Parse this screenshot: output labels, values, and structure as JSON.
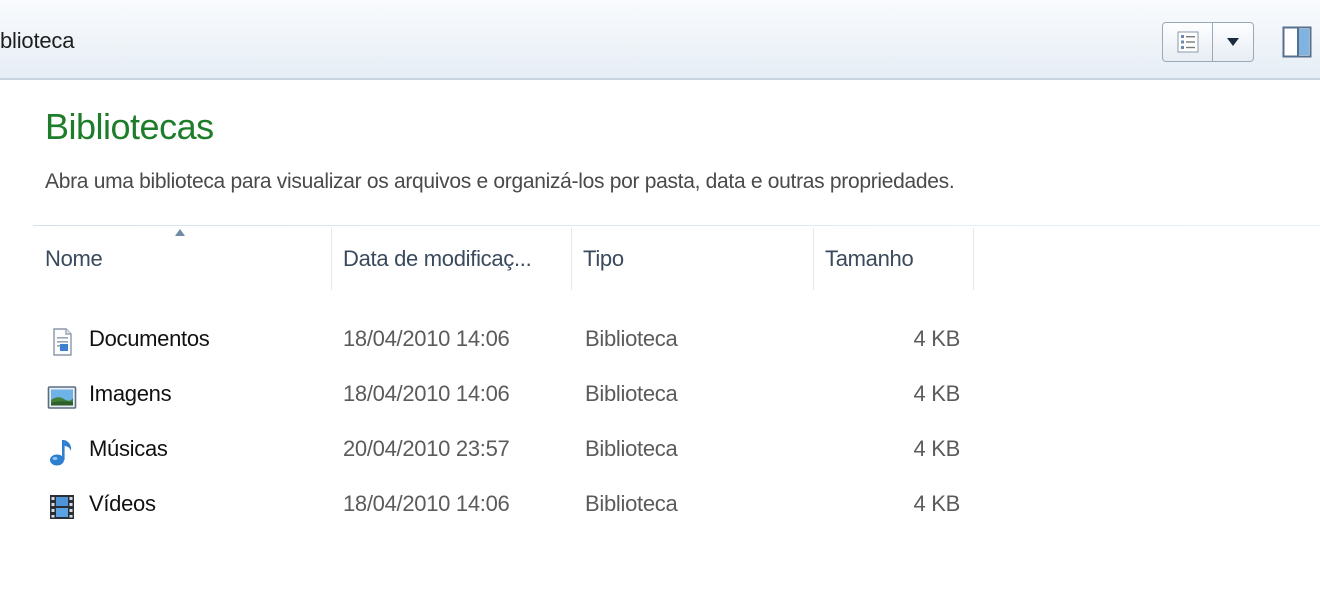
{
  "toolbar": {
    "breadcrumb": "blioteca",
    "view_button_icon": "details-view-icon",
    "view_dropdown_icon": "chevron-down-icon",
    "preview_pane_icon": "preview-pane-icon"
  },
  "header": {
    "title": "Bibliotecas",
    "subtitle": "Abra uma biblioteca para visualizar os arquivos e organizá-los por pasta, data e outras propriedades."
  },
  "columns": {
    "name": "Nome",
    "date": "Data de modificaç...",
    "type": "Tipo",
    "size": "Tamanho",
    "sorted_by": "name"
  },
  "rows": [
    {
      "name": "Documentos",
      "date": "18/04/2010 14:06",
      "type": "Biblioteca",
      "size": "4 KB",
      "icon": "documents-library-icon"
    },
    {
      "name": "Imagens",
      "date": "18/04/2010 14:06",
      "type": "Biblioteca",
      "size": "4 KB",
      "icon": "pictures-library-icon"
    },
    {
      "name": "Músicas",
      "date": "20/04/2010 23:57",
      "type": "Biblioteca",
      "size": "4 KB",
      "icon": "music-library-icon"
    },
    {
      "name": "Vídeos",
      "date": "18/04/2010 14:06",
      "type": "Biblioteca",
      "size": "4 KB",
      "icon": "videos-library-icon"
    }
  ],
  "colors": {
    "title": "#1e7d2a",
    "toolbar_bg": "#eef3f9",
    "header_text": "#3a4a5c"
  }
}
